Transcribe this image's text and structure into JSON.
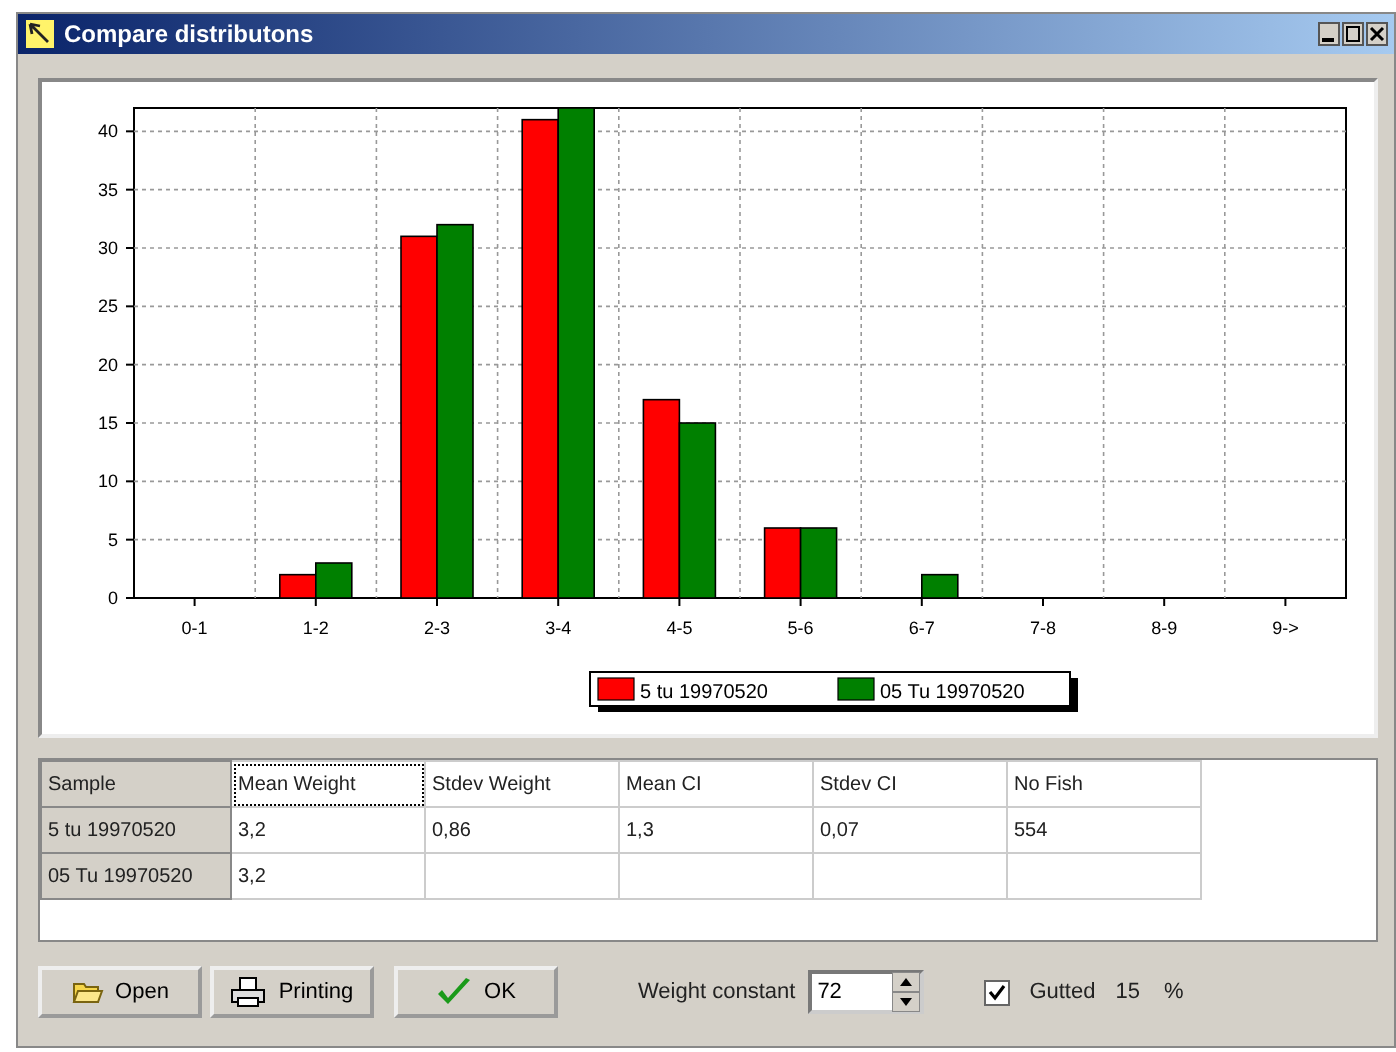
{
  "window": {
    "title": "Compare distributons"
  },
  "chart": {
    "chart_data": {
      "type": "bar",
      "categories": [
        "0-1",
        "1-2",
        "2-3",
        "3-4",
        "4-5",
        "5-6",
        "6-7",
        "7-8",
        "8-9",
        "9->"
      ],
      "series": [
        {
          "name": "5 tu 19970520",
          "color": "#ff0000",
          "values": [
            0,
            2,
            31,
            41,
            17,
            6,
            0,
            0,
            0,
            0
          ]
        },
        {
          "name": "05 Tu 19970520",
          "color": "#008000",
          "values": [
            0,
            3,
            32,
            42,
            15,
            6,
            2,
            0,
            0,
            0
          ]
        }
      ],
      "ylim": [
        0,
        42
      ],
      "grid": true,
      "legend": true,
      "yticks": [
        0,
        5,
        10,
        15,
        20,
        25,
        30,
        35,
        40
      ]
    }
  },
  "table": {
    "columns": [
      "Sample",
      "Mean Weight",
      "Stdev Weight",
      "Mean CI",
      "Stdev CI",
      "No Fish"
    ],
    "rows": [
      {
        "sample": "5 tu 19970520",
        "values": [
          "3,2",
          "0,86",
          "1,3",
          "0,07",
          "554"
        ]
      },
      {
        "sample": "05 Tu 19970520",
        "values": [
          "3,2"
        ]
      }
    ]
  },
  "buttons": [
    {
      "label": "Open",
      "kind": "open"
    },
    {
      "label": "Printing",
      "kind": "print"
    },
    {
      "label": "OK",
      "kind": "ok"
    }
  ],
  "weight_constant": {
    "label": "Weight constant",
    "value": "72"
  },
  "gutted": {
    "label": "Gutted",
    "checked": true,
    "value": "15",
    "unit": "%"
  }
}
